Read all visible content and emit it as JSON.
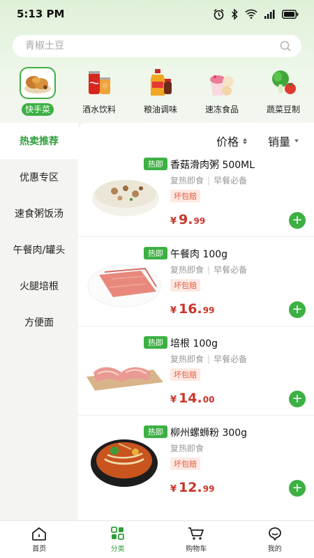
{
  "status_bar": {
    "time": "5:13 PM",
    "battery": "88"
  },
  "search": {
    "placeholder": "青椒土豆"
  },
  "categories": [
    {
      "label": "快手菜",
      "icon": "fried-food-icon",
      "active": true
    },
    {
      "label": "酒水饮料",
      "icon": "drink-cans-icon",
      "active": false
    },
    {
      "label": "粮油调味",
      "icon": "oil-bottle-icon",
      "active": false
    },
    {
      "label": "速冻食品",
      "icon": "frozen-dessert-icon",
      "active": false
    },
    {
      "label": "蔬菜豆制",
      "icon": "vegetable-icon",
      "active": false
    }
  ],
  "sidebar": {
    "items": [
      {
        "label": "热卖推荐",
        "active": true
      },
      {
        "label": "优惠专区",
        "active": false
      },
      {
        "label": "速食粥饭汤",
        "active": false
      },
      {
        "label": "午餐肉/罐头",
        "active": false
      },
      {
        "label": "火腿培根",
        "active": false
      },
      {
        "label": "方便面",
        "active": false
      }
    ]
  },
  "sort": {
    "price_label": "价格",
    "sales_label": "销量"
  },
  "products": [
    {
      "name": "香菇滑肉粥 500ML",
      "badge": "热即",
      "tags": [
        "复热即食",
        "早餐必备"
      ],
      "guarantee": "坏包赔",
      "price_symbol": "¥",
      "price_int": "9.",
      "price_dec": "99",
      "image": "porridge-bowl-icon"
    },
    {
      "name": "午餐肉 100g",
      "badge": "热即",
      "tags": [
        "复热即食",
        "早餐必备"
      ],
      "guarantee": "坏包赔",
      "price_symbol": "¥",
      "price_int": "16.",
      "price_dec": "99",
      "image": "luncheon-meat-icon"
    },
    {
      "name": "培根 100g",
      "badge": "热即",
      "tags": [
        "复热即食",
        "早餐必备"
      ],
      "guarantee": "坏包赔",
      "price_symbol": "¥",
      "price_int": "14.",
      "price_dec": "00",
      "image": "bacon-icon"
    },
    {
      "name": "柳州螺蛳粉 300g",
      "badge": "热即",
      "tags": [
        "复热即食"
      ],
      "guarantee": "坏包赔",
      "price_symbol": "¥",
      "price_int": "12.",
      "price_dec": "99",
      "image": "rice-noodle-bowl-icon"
    }
  ],
  "tab_bar": [
    {
      "label": "首页",
      "icon": "home-icon",
      "active": false
    },
    {
      "label": "分类",
      "icon": "category-grid-icon",
      "active": true
    },
    {
      "label": "购物车",
      "icon": "cart-icon",
      "active": false
    },
    {
      "label": "我的",
      "icon": "profile-icon",
      "active": false
    }
  ],
  "colors": {
    "accent": "#3cb043",
    "price": "#c9352a",
    "guarantee": "#e3573b"
  }
}
